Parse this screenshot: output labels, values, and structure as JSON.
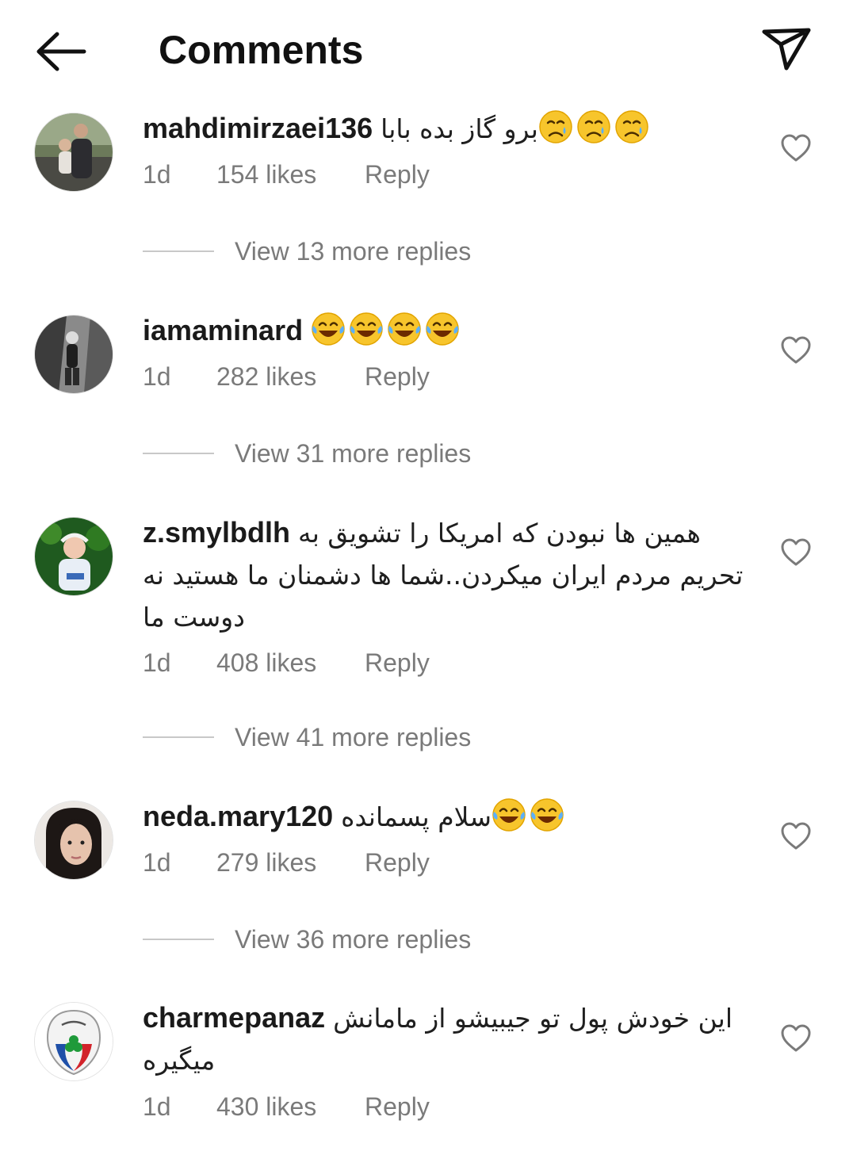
{
  "header": {
    "title": "Comments",
    "back_icon": "arrow-left-icon",
    "share_icon": "paper-plane-icon"
  },
  "colors": {
    "text": "#111111",
    "secondary": "#7a7a7a",
    "divider": "#c8c8c8",
    "background": "#ffffff"
  },
  "comments": [
    {
      "username": "mahdimirzaei136",
      "text": "برو گاز بده بابا",
      "emoji_type": "crying-face",
      "emoji_count": 3,
      "time": "1d",
      "likes": "154 likes",
      "reply": "Reply",
      "view_replies": "View 13 more replies"
    },
    {
      "username": "iamaminard",
      "text": "",
      "emoji_type": "tears-of-joy",
      "emoji_count": 4,
      "time": "1d",
      "likes": "282 likes",
      "reply": "Reply",
      "view_replies": "View 31 more replies"
    },
    {
      "username": "z.smylbdlh",
      "text": "همین ها نبودن که امریکا را تشویق به تحریم مردم ایران میکردن..شما ها دشمنان ما هستید نه دوست ما",
      "emoji_type": "",
      "emoji_count": 0,
      "time": "1d",
      "likes": "408 likes",
      "reply": "Reply",
      "view_replies": "View 41 more replies"
    },
    {
      "username": "neda.mary120",
      "text": "سلام پسمانده",
      "emoji_type": "tears-of-joy",
      "emoji_count": 2,
      "time": "1d",
      "likes": "279 likes",
      "reply": "Reply",
      "view_replies": "View 36 more replies"
    },
    {
      "username": "charmepanaz",
      "text": "این خودش پول تو جیبیشو از مامانش میگیره",
      "emoji_type": "",
      "emoji_count": 0,
      "time": "1d",
      "likes": "430 likes",
      "reply": "Reply",
      "view_replies": ""
    }
  ]
}
